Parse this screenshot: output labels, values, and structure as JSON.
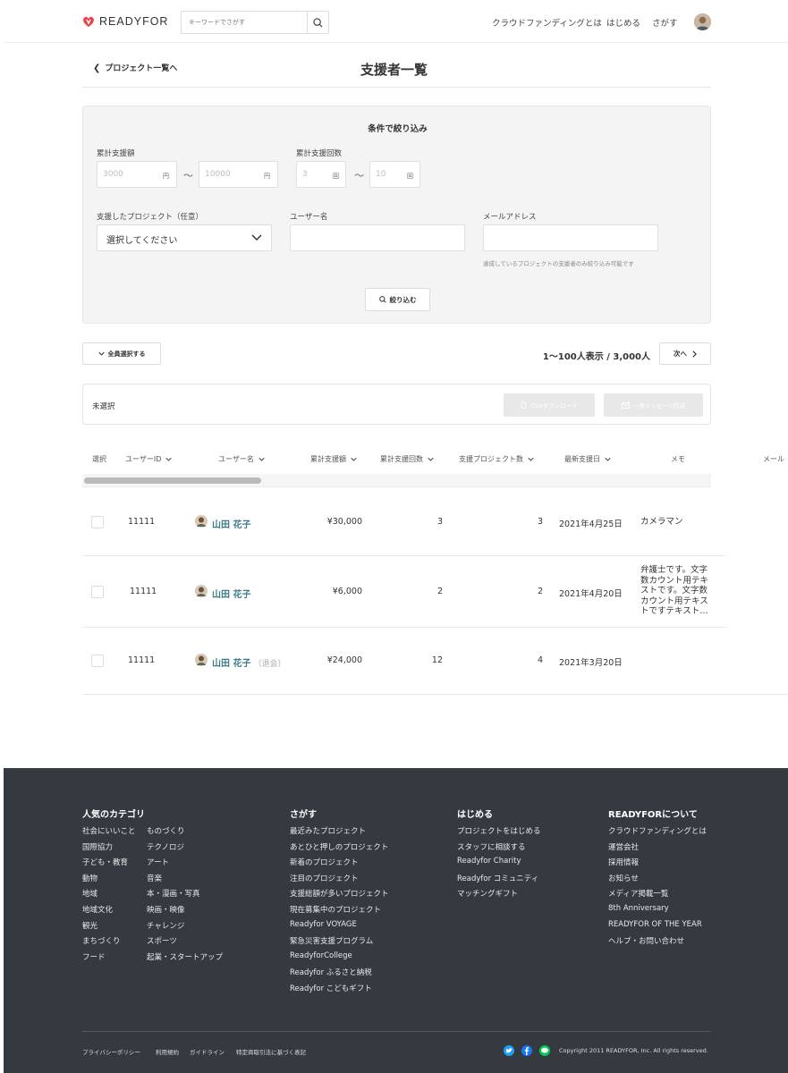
{
  "header": {
    "logo_text": "READYFOR",
    "search_placeholder": "キーワードでさがす",
    "nav": [
      "クラウドファンディングとは",
      "はじめる",
      "さがす"
    ]
  },
  "page": {
    "back_link": "プロジェクト一覧へ",
    "title": "支援者一覧"
  },
  "filter": {
    "title": "条件で絞り込み",
    "total_amount_label": "累計支援額",
    "amount_min": "3000",
    "amount_max": "10000",
    "amount_unit": "円",
    "tilde": "〜",
    "count_label": "累計支援回数",
    "count_min": "3",
    "count_max": "10",
    "count_unit": "回",
    "project_label": "支援したプロジェクト（任意）",
    "project_placeholder": "選択してください",
    "username_label": "ユーザー名",
    "email_label": "メールアドレス",
    "email_hint": "達成しているプロジェクトの支援者のみ絞り込み可能です",
    "submit_label": "絞り込む"
  },
  "toolbar": {
    "select_all": "全員選択する",
    "result_count": "1〜100人表示 / 3,000人",
    "next": "次へ"
  },
  "selection": {
    "status": "未選択",
    "csv_button": "CSVダウンロード",
    "message_button": "一斉メッセージ作成"
  },
  "table": {
    "headers": [
      "選択",
      "ユーザーID",
      "ユーザー名",
      "累計支援額",
      "累計支援回数",
      "支援プロジェクト数",
      "最新支援日",
      "メモ",
      "メール"
    ],
    "rows": [
      {
        "id": "11111",
        "name": "山田 花子",
        "withdrawn": "",
        "amount": "¥30,000",
        "count": "3",
        "projects": "3",
        "date": "2021年4月25日",
        "memo": "カメラマン"
      },
      {
        "id": "11111",
        "name": "山田 花子",
        "withdrawn": "",
        "amount": "¥6,000",
        "count": "2",
        "projects": "2",
        "date": "2021年4月20日",
        "memo": "弁護士です。文字数カウント用テキストです。文字数カウント用テキストですテキスト…"
      },
      {
        "id": "11111",
        "name": "山田 花子",
        "withdrawn": "（退会）",
        "amount": "¥24,000",
        "count": "12",
        "projects": "4",
        "date": "2021年3月20日",
        "memo": ""
      }
    ]
  },
  "footer": {
    "categories_title": "人気のカテゴリ",
    "categories_col1": [
      "社会にいいこと",
      "国際協力",
      "子ども・教育",
      "動物",
      "地域",
      "地域文化",
      "観光",
      "まちづくり",
      "フード"
    ],
    "categories_col2": [
      "ものづくり",
      "テクノロジ",
      "アート",
      "音楽",
      "本・漫画・写真",
      "映画・映像",
      "チャレンジ",
      "スポーツ",
      "起業・スタートアップ"
    ],
    "search_title": "さがす",
    "search_links": [
      "最近みたプロジェクト",
      "あとひと押しのプロジェクト",
      "新着のプロジェクト",
      "注目のプロジェクト",
      "支援総額が多いプロジェクト",
      "現在募集中のプロジェクト",
      "Readyfor VOYAGE",
      "緊急災害支援プログラム",
      "ReadyforCollege",
      "Readyfor ふるさと納税",
      "Readyfor こどもギフト"
    ],
    "start_title": "はじめる",
    "start_links": [
      "プロジェクトをはじめる",
      "スタッフに相談する",
      "Readyfor Charity",
      "Readyfor コミュニティ",
      "マッチングギフト"
    ],
    "about_title": "READYFORについて",
    "about_links": [
      "クラウドファンディングとは",
      "運営会社",
      "採用情報",
      "お知らせ",
      "メディア掲載一覧",
      "8th Anniversary",
      "READYFOR OF THE YEAR",
      "ヘルプ・お問い合わせ"
    ],
    "bottom_links": [
      "プライバシーポリシー",
      "利用規約",
      "ガイドライン",
      "特定商取引法に基づく表記"
    ],
    "copyright": "Copyright 2011 READYFOR, Inc. All rights reserved.",
    "social_icons": [
      "twitter-icon",
      "facebook-icon",
      "line-icon"
    ]
  }
}
